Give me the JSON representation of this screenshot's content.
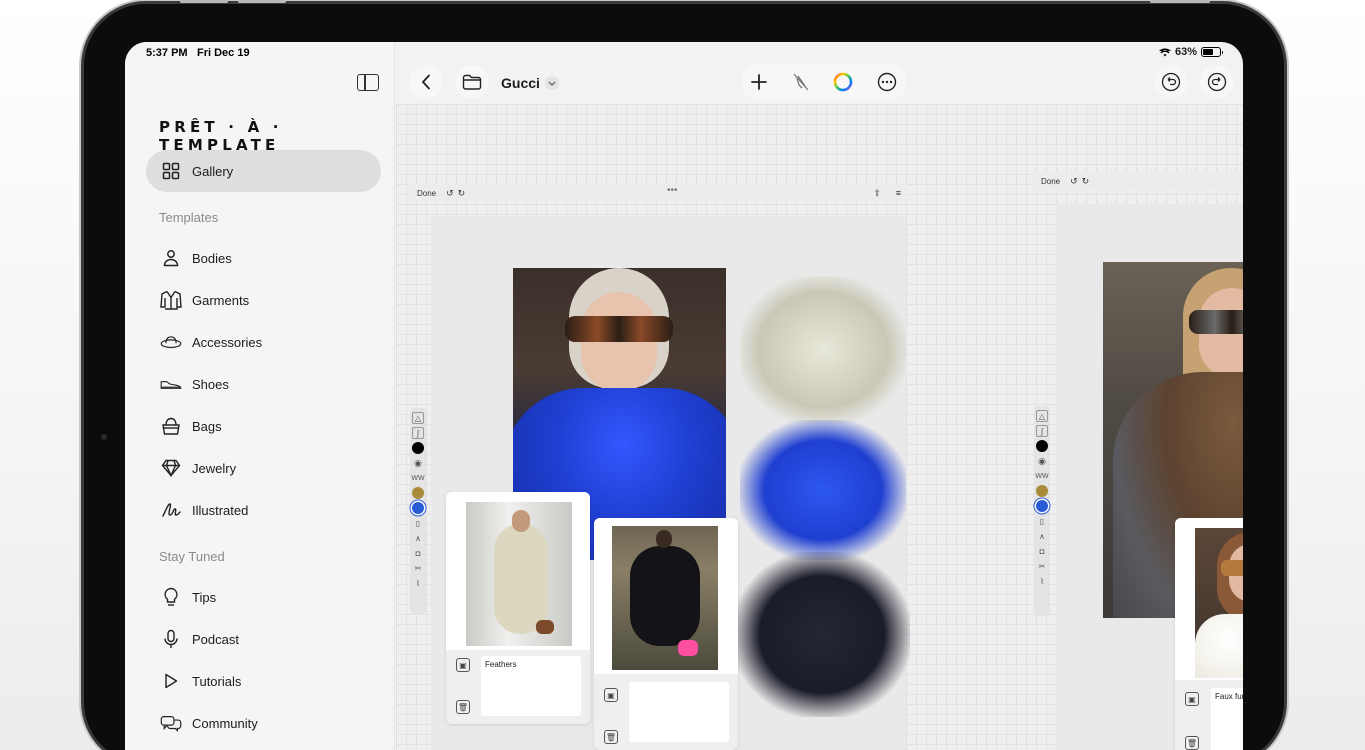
{
  "status_bar": {
    "time": "5:37 PM",
    "date": "Fri Dec 19",
    "battery": "63%",
    "battery_level": 0.63
  },
  "sidebar": {
    "brand": "PRÊT · À · TEMPLATE",
    "gallery": {
      "label": "Gallery",
      "icon": "grid-icon"
    },
    "templates_section": "Templates",
    "templates": [
      {
        "label": "Bodies",
        "icon": "person-icon"
      },
      {
        "label": "Garments",
        "icon": "jacket-icon"
      },
      {
        "label": "Accessories",
        "icon": "hat-icon"
      },
      {
        "label": "Shoes",
        "icon": "shoe-icon"
      },
      {
        "label": "Bags",
        "icon": "bag-icon"
      },
      {
        "label": "Jewelry",
        "icon": "diamond-icon"
      },
      {
        "label": "Illustrated",
        "icon": "scribble-icon"
      }
    ],
    "stay_tuned_section": "Stay Tuned",
    "stay_tuned": [
      {
        "label": "Tips",
        "icon": "lightbulb-icon"
      },
      {
        "label": "Podcast",
        "icon": "microphone-icon"
      },
      {
        "label": "Tutorials",
        "icon": "play-icon"
      },
      {
        "label": "Community",
        "icon": "chat-bubbles-icon"
      }
    ]
  },
  "toolbar": {
    "title": "Gucci"
  },
  "canvas": {
    "page_left": {
      "done": "Done",
      "card_notes": [
        "Feathers",
        ""
      ]
    },
    "page_right": {
      "done": "Done",
      "card_note": "Faux furs."
    }
  },
  "colors": {
    "accent_blue": "#1f3fd1",
    "fur_black": "#1b1c2a",
    "fur_cream": "#d9d8c8"
  }
}
